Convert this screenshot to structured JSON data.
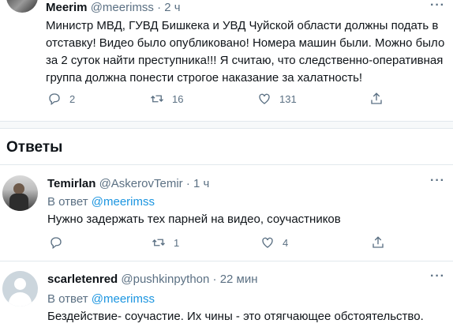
{
  "main_tweet": {
    "name": "Meerim",
    "handle": "@meerimss",
    "time": "· 2 ч",
    "text_lines": [
      "Министр МВД, ГУВД Бишкека и УВД Чуйской области должны подать в",
      "отставку! Видео было опубликовано! Номера машин были. Можно было",
      "за 2 суток найти преступника!!! Я считаю, что следственно-оперативная",
      "группа должна понести строгое наказание за халатность!"
    ],
    "replies": "2",
    "retweets": "16",
    "likes": "131"
  },
  "section_title": "Ответы",
  "replies": [
    {
      "name": "Temirlan",
      "handle": "@AskerovTemir",
      "time": "· 1 ч",
      "reply_prefix": "В ответ",
      "reply_to": "@meerimss",
      "text": "Нужно задержать тех парней на видео, соучастников",
      "replies": "",
      "retweets": "1",
      "likes": "4"
    },
    {
      "name": "scarletenred",
      "handle": "@pushkinpython",
      "time": "· 22 мин",
      "reply_prefix": "В ответ",
      "reply_to": "@meerimss",
      "text": "Бездействие- соучастие. Их чины - это отягчающее обстоятельство."
    }
  ],
  "colors": {
    "link": "#1b95e0",
    "muted": "#5b7083",
    "divider": "#e1e8ed"
  },
  "icons": [
    "reply-icon",
    "retweet-icon",
    "like-icon",
    "share-icon",
    "more-icon"
  ]
}
